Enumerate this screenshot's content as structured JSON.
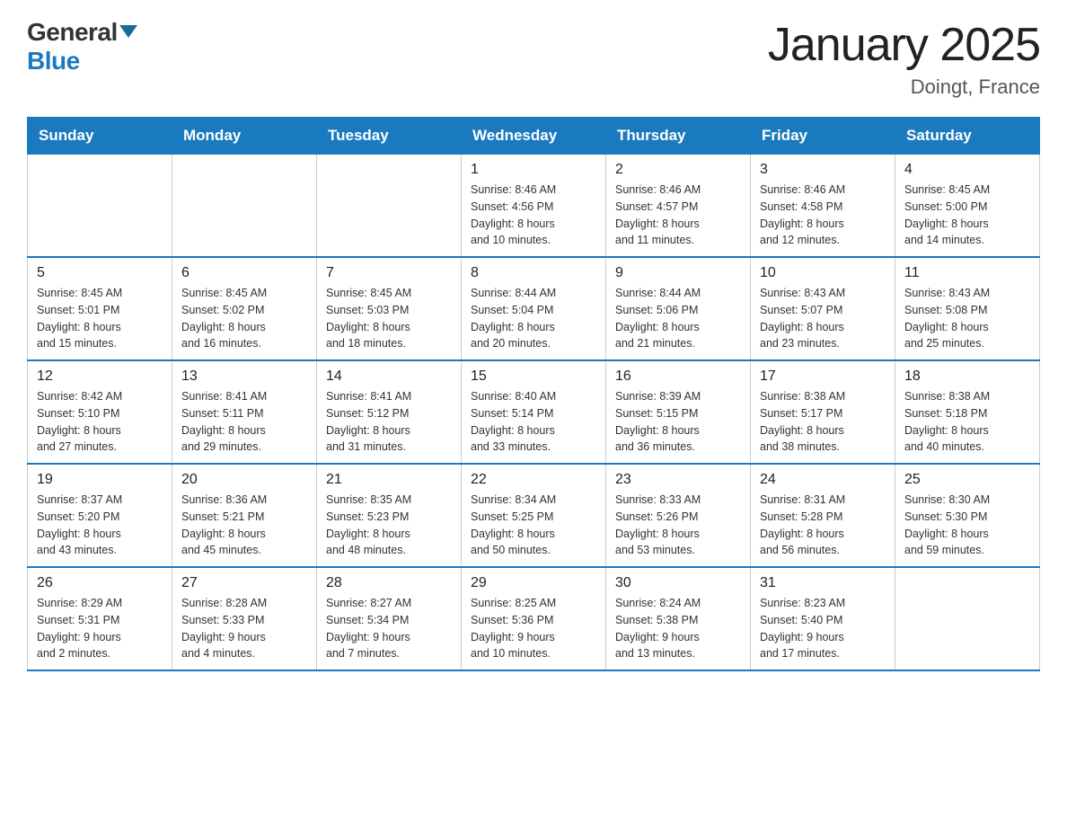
{
  "logo": {
    "text_general": "General",
    "text_blue": "Blue"
  },
  "title": "January 2025",
  "subtitle": "Doingt, France",
  "days_of_week": [
    "Sunday",
    "Monday",
    "Tuesday",
    "Wednesday",
    "Thursday",
    "Friday",
    "Saturday"
  ],
  "weeks": [
    [
      {
        "day": "",
        "info": ""
      },
      {
        "day": "",
        "info": ""
      },
      {
        "day": "",
        "info": ""
      },
      {
        "day": "1",
        "info": "Sunrise: 8:46 AM\nSunset: 4:56 PM\nDaylight: 8 hours\nand 10 minutes."
      },
      {
        "day": "2",
        "info": "Sunrise: 8:46 AM\nSunset: 4:57 PM\nDaylight: 8 hours\nand 11 minutes."
      },
      {
        "day": "3",
        "info": "Sunrise: 8:46 AM\nSunset: 4:58 PM\nDaylight: 8 hours\nand 12 minutes."
      },
      {
        "day": "4",
        "info": "Sunrise: 8:45 AM\nSunset: 5:00 PM\nDaylight: 8 hours\nand 14 minutes."
      }
    ],
    [
      {
        "day": "5",
        "info": "Sunrise: 8:45 AM\nSunset: 5:01 PM\nDaylight: 8 hours\nand 15 minutes."
      },
      {
        "day": "6",
        "info": "Sunrise: 8:45 AM\nSunset: 5:02 PM\nDaylight: 8 hours\nand 16 minutes."
      },
      {
        "day": "7",
        "info": "Sunrise: 8:45 AM\nSunset: 5:03 PM\nDaylight: 8 hours\nand 18 minutes."
      },
      {
        "day": "8",
        "info": "Sunrise: 8:44 AM\nSunset: 5:04 PM\nDaylight: 8 hours\nand 20 minutes."
      },
      {
        "day": "9",
        "info": "Sunrise: 8:44 AM\nSunset: 5:06 PM\nDaylight: 8 hours\nand 21 minutes."
      },
      {
        "day": "10",
        "info": "Sunrise: 8:43 AM\nSunset: 5:07 PM\nDaylight: 8 hours\nand 23 minutes."
      },
      {
        "day": "11",
        "info": "Sunrise: 8:43 AM\nSunset: 5:08 PM\nDaylight: 8 hours\nand 25 minutes."
      }
    ],
    [
      {
        "day": "12",
        "info": "Sunrise: 8:42 AM\nSunset: 5:10 PM\nDaylight: 8 hours\nand 27 minutes."
      },
      {
        "day": "13",
        "info": "Sunrise: 8:41 AM\nSunset: 5:11 PM\nDaylight: 8 hours\nand 29 minutes."
      },
      {
        "day": "14",
        "info": "Sunrise: 8:41 AM\nSunset: 5:12 PM\nDaylight: 8 hours\nand 31 minutes."
      },
      {
        "day": "15",
        "info": "Sunrise: 8:40 AM\nSunset: 5:14 PM\nDaylight: 8 hours\nand 33 minutes."
      },
      {
        "day": "16",
        "info": "Sunrise: 8:39 AM\nSunset: 5:15 PM\nDaylight: 8 hours\nand 36 minutes."
      },
      {
        "day": "17",
        "info": "Sunrise: 8:38 AM\nSunset: 5:17 PM\nDaylight: 8 hours\nand 38 minutes."
      },
      {
        "day": "18",
        "info": "Sunrise: 8:38 AM\nSunset: 5:18 PM\nDaylight: 8 hours\nand 40 minutes."
      }
    ],
    [
      {
        "day": "19",
        "info": "Sunrise: 8:37 AM\nSunset: 5:20 PM\nDaylight: 8 hours\nand 43 minutes."
      },
      {
        "day": "20",
        "info": "Sunrise: 8:36 AM\nSunset: 5:21 PM\nDaylight: 8 hours\nand 45 minutes."
      },
      {
        "day": "21",
        "info": "Sunrise: 8:35 AM\nSunset: 5:23 PM\nDaylight: 8 hours\nand 48 minutes."
      },
      {
        "day": "22",
        "info": "Sunrise: 8:34 AM\nSunset: 5:25 PM\nDaylight: 8 hours\nand 50 minutes."
      },
      {
        "day": "23",
        "info": "Sunrise: 8:33 AM\nSunset: 5:26 PM\nDaylight: 8 hours\nand 53 minutes."
      },
      {
        "day": "24",
        "info": "Sunrise: 8:31 AM\nSunset: 5:28 PM\nDaylight: 8 hours\nand 56 minutes."
      },
      {
        "day": "25",
        "info": "Sunrise: 8:30 AM\nSunset: 5:30 PM\nDaylight: 8 hours\nand 59 minutes."
      }
    ],
    [
      {
        "day": "26",
        "info": "Sunrise: 8:29 AM\nSunset: 5:31 PM\nDaylight: 9 hours\nand 2 minutes."
      },
      {
        "day": "27",
        "info": "Sunrise: 8:28 AM\nSunset: 5:33 PM\nDaylight: 9 hours\nand 4 minutes."
      },
      {
        "day": "28",
        "info": "Sunrise: 8:27 AM\nSunset: 5:34 PM\nDaylight: 9 hours\nand 7 minutes."
      },
      {
        "day": "29",
        "info": "Sunrise: 8:25 AM\nSunset: 5:36 PM\nDaylight: 9 hours\nand 10 minutes."
      },
      {
        "day": "30",
        "info": "Sunrise: 8:24 AM\nSunset: 5:38 PM\nDaylight: 9 hours\nand 13 minutes."
      },
      {
        "day": "31",
        "info": "Sunrise: 8:23 AM\nSunset: 5:40 PM\nDaylight: 9 hours\nand 17 minutes."
      },
      {
        "day": "",
        "info": ""
      }
    ]
  ]
}
